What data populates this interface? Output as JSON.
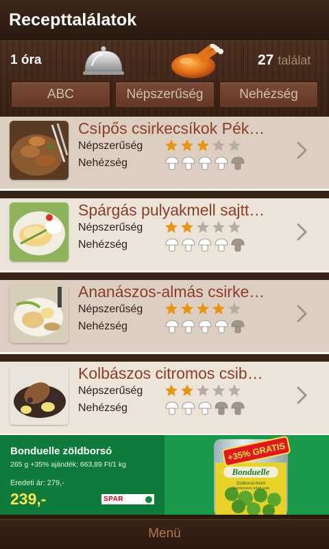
{
  "header": {
    "title": "Recepttalálatok"
  },
  "toolbar": {
    "time_label": "1 óra",
    "results_count": "27",
    "results_label": "találat",
    "sort_buttons": [
      "ABC",
      "Népszerűség",
      "Nehézség"
    ]
  },
  "labels": {
    "popularity": "Népszerűség",
    "difficulty": "Nehézség"
  },
  "recipes": [
    {
      "name": "Csípős csirkecsíkok Pék…",
      "popularity": 3,
      "difficulty": 4,
      "max": 5
    },
    {
      "name": "Spárgás pulyakmell sajtt…",
      "popularity": 2,
      "difficulty": 4,
      "max": 5
    },
    {
      "name": "Ananászos-almás csirke…",
      "popularity": 4,
      "difficulty": 4,
      "max": 5
    },
    {
      "name": "Kolbászos citromos csib…",
      "popularity": 2,
      "difficulty": 3,
      "max": 5
    }
  ],
  "ad": {
    "title": "Bonduelle zöldborsó",
    "description": "265 g +35% ajándék; 663,89 Ft/1 kg",
    "original_price": "Eredeti ár: 279,-",
    "price": "239,-",
    "store": "SPAR",
    "promo_badge": "+35% GRATIS",
    "product_brand": "Bonduelle",
    "product_line1": "Zöldborsó finom",
    "product_line2": "Starkkonzerv mladi grah"
  },
  "bottom": {
    "menu_label": "Menü"
  },
  "colors": {
    "recipe_title": "#8b3d28",
    "star_on": "#e8940e",
    "star_off": "#b6aca2",
    "ad_green": "#0e7a3c",
    "price_yellow": "#ffe44a"
  },
  "icons": {
    "time": "clock-text",
    "dish": "cloche-icon",
    "chicken": "roast-chicken-icon",
    "arrow": "chevron-right-icon",
    "star": "star-icon",
    "difficulty": "mushroom-icon"
  }
}
